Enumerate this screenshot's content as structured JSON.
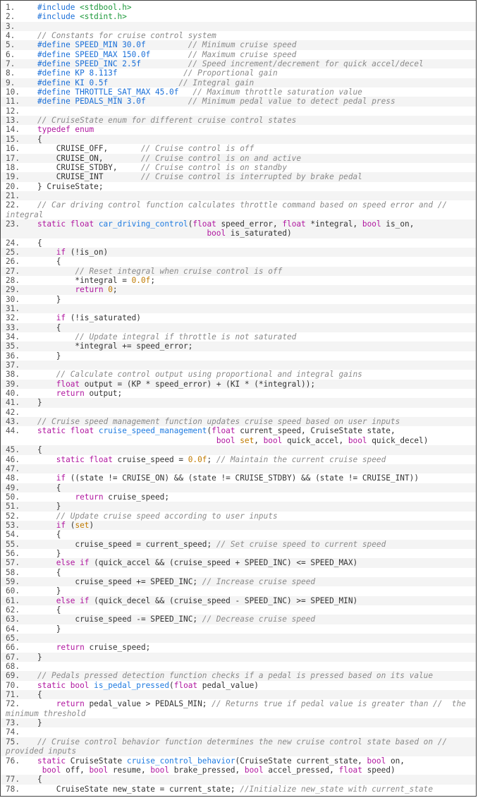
{
  "colors": {
    "preprocessor": "#1a6fd8",
    "string": "#1f9a3c",
    "comment": "#8a8a8a",
    "keyword": "#b0169f",
    "function": "#1f7be0",
    "number": "#c07a00",
    "text": "#333333"
  },
  "rows": [
    {
      "n": "1.",
      "tokens": [
        [
          "p",
          "#include "
        ],
        [
          "s",
          "<stdbool.h>"
        ]
      ]
    },
    {
      "n": "2.",
      "tokens": [
        [
          "p",
          "#include "
        ],
        [
          "s",
          "<stdint.h>"
        ]
      ]
    },
    {
      "n": "3.",
      "tokens": []
    },
    {
      "n": "4.",
      "tokens": [
        [
          "c",
          "// Constants for cruise control system"
        ]
      ]
    },
    {
      "n": "5.",
      "tokens": [
        [
          "p",
          "#define SPEED_MIN 30.0f"
        ],
        [
          "t",
          "         "
        ],
        [
          "c",
          "// Minimum cruise speed"
        ]
      ]
    },
    {
      "n": "6.",
      "tokens": [
        [
          "p",
          "#define SPEED_MAX 150.0f"
        ],
        [
          "t",
          "        "
        ],
        [
          "c",
          "// Maximum cruise speed"
        ]
      ]
    },
    {
      "n": "7.",
      "tokens": [
        [
          "p",
          "#define SPEED_INC 2.5f"
        ],
        [
          "t",
          "          "
        ],
        [
          "c",
          "// Speed increment/decrement for quick accel/decel"
        ]
      ]
    },
    {
      "n": "8.",
      "tokens": [
        [
          "p",
          "#define KP 8.113f"
        ],
        [
          "t",
          "              "
        ],
        [
          "c",
          "// Proportional gain"
        ]
      ]
    },
    {
      "n": "9.",
      "tokens": [
        [
          "p",
          "#define KI 0.5f"
        ],
        [
          "t",
          "               "
        ],
        [
          "c",
          "// Integral gain"
        ]
      ]
    },
    {
      "n": "10.",
      "tokens": [
        [
          "p",
          "#define THROTTLE_SAT_MAX 45.0f"
        ],
        [
          "t",
          "   "
        ],
        [
          "c",
          "// Maximum throttle saturation value"
        ]
      ]
    },
    {
      "n": "11.",
      "tokens": [
        [
          "p",
          "#define PEDALS_MIN 3.0f"
        ],
        [
          "t",
          "         "
        ],
        [
          "c",
          "// Minimum pedal value to detect pedal press"
        ]
      ]
    },
    {
      "n": "12.",
      "tokens": []
    },
    {
      "n": "13.",
      "tokens": [
        [
          "c",
          "// CruiseState enum for different cruise control states"
        ]
      ]
    },
    {
      "n": "14.",
      "tokens": [
        [
          "k",
          "typedef enum"
        ]
      ]
    },
    {
      "n": "15.",
      "tokens": [
        [
          "t",
          "{"
        ]
      ]
    },
    {
      "n": "16.",
      "tokens": [
        [
          "t",
          "    CRUISE_OFF,       "
        ],
        [
          "c",
          "// Cruise control is off"
        ]
      ]
    },
    {
      "n": "17.",
      "tokens": [
        [
          "t",
          "    CRUISE_ON,        "
        ],
        [
          "c",
          "// Cruise control is on and active"
        ]
      ]
    },
    {
      "n": "18.",
      "tokens": [
        [
          "t",
          "    CRUISE_STDBY,     "
        ],
        [
          "c",
          "// Cruise control is on standby"
        ]
      ]
    },
    {
      "n": "19.",
      "tokens": [
        [
          "t",
          "    CRUISE_INT        "
        ],
        [
          "c",
          "// Cruise control is interrupted by brake pedal"
        ]
      ]
    },
    {
      "n": "20.",
      "tokens": [
        [
          "t",
          "} CruiseState;"
        ]
      ]
    },
    {
      "n": "21.",
      "tokens": []
    },
    {
      "n": "22.",
      "tokens": [
        [
          "c",
          "// Car driving control function calculates throttle command based on speed error and //"
        ]
      ]
    },
    {
      "n": "",
      "wrap": true,
      "tokens": [
        [
          "c",
          "integral"
        ]
      ]
    },
    {
      "n": "23.",
      "tokens": [
        [
          "k",
          "static float "
        ],
        [
          "f",
          "car_driving_control"
        ],
        [
          "t",
          "("
        ],
        [
          "k",
          "float"
        ],
        [
          "t",
          " speed_error, "
        ],
        [
          "k",
          "float"
        ],
        [
          "t",
          " *integral, "
        ],
        [
          "k",
          "bool"
        ],
        [
          "t",
          " is_on,"
        ]
      ]
    },
    {
      "n": "",
      "tokens": [
        [
          "t",
          "                                    "
        ],
        [
          "k",
          "bool"
        ],
        [
          "t",
          " is_saturated)"
        ]
      ]
    },
    {
      "n": "24.",
      "tokens": [
        [
          "t",
          "{"
        ]
      ]
    },
    {
      "n": "25.",
      "tokens": [
        [
          "t",
          "    "
        ],
        [
          "k",
          "if"
        ],
        [
          "t",
          " (!is_on)"
        ]
      ]
    },
    {
      "n": "26.",
      "tokens": [
        [
          "t",
          "    {"
        ]
      ]
    },
    {
      "n": "27.",
      "tokens": [
        [
          "t",
          "        "
        ],
        [
          "c",
          "// Reset integral when cruise control is off"
        ]
      ]
    },
    {
      "n": "28.",
      "tokens": [
        [
          "t",
          "        *integral = "
        ],
        [
          "n",
          "0.0f"
        ],
        [
          "t",
          ";"
        ]
      ]
    },
    {
      "n": "29.",
      "tokens": [
        [
          "t",
          "        "
        ],
        [
          "k",
          "return "
        ],
        [
          "n",
          "0"
        ],
        [
          "t",
          ";"
        ]
      ]
    },
    {
      "n": "30.",
      "tokens": [
        [
          "t",
          "    }"
        ]
      ]
    },
    {
      "n": "31.",
      "tokens": []
    },
    {
      "n": "32.",
      "tokens": [
        [
          "t",
          "    "
        ],
        [
          "k",
          "if"
        ],
        [
          "t",
          " (!is_saturated)"
        ]
      ]
    },
    {
      "n": "33.",
      "tokens": [
        [
          "t",
          "    {"
        ]
      ]
    },
    {
      "n": "34.",
      "tokens": [
        [
          "t",
          "        "
        ],
        [
          "c",
          "// Update integral if throttle is not saturated"
        ]
      ]
    },
    {
      "n": "35.",
      "tokens": [
        [
          "t",
          "        *integral += speed_error;"
        ]
      ]
    },
    {
      "n": "36.",
      "tokens": [
        [
          "t",
          "    }"
        ]
      ]
    },
    {
      "n": "37.",
      "tokens": []
    },
    {
      "n": "38.",
      "tokens": [
        [
          "t",
          "    "
        ],
        [
          "c",
          "// Calculate control output using proportional and integral gains"
        ]
      ]
    },
    {
      "n": "39.",
      "tokens": [
        [
          "t",
          "    "
        ],
        [
          "k",
          "float"
        ],
        [
          "t",
          " output = (KP * speed_error) + (KI * (*integral));"
        ]
      ]
    },
    {
      "n": "40.",
      "tokens": [
        [
          "t",
          "    "
        ],
        [
          "k",
          "return"
        ],
        [
          "t",
          " output;"
        ]
      ]
    },
    {
      "n": "41.",
      "tokens": [
        [
          "t",
          "}"
        ]
      ]
    },
    {
      "n": "42.",
      "tokens": []
    },
    {
      "n": "43.",
      "tokens": [
        [
          "c",
          "// Cruise speed management function updates cruise speed based on user inputs"
        ]
      ]
    },
    {
      "n": "44.",
      "tokens": [
        [
          "k",
          "static float "
        ],
        [
          "f",
          "cruise_speed_management"
        ],
        [
          "t",
          "("
        ],
        [
          "k",
          "float"
        ],
        [
          "t",
          " current_speed, CruiseState state,"
        ]
      ]
    },
    {
      "n": "",
      "tokens": [
        [
          "t",
          "                                      "
        ],
        [
          "k",
          "bool"
        ],
        [
          "t",
          " "
        ],
        [
          "n",
          "set"
        ],
        [
          "t",
          ", "
        ],
        [
          "k",
          "bool"
        ],
        [
          "t",
          " quick_accel, "
        ],
        [
          "k",
          "bool"
        ],
        [
          "t",
          " quick_decel)"
        ]
      ]
    },
    {
      "n": "45.",
      "tokens": [
        [
          "t",
          "{"
        ]
      ]
    },
    {
      "n": "46.",
      "tokens": [
        [
          "t",
          "    "
        ],
        [
          "k",
          "static float"
        ],
        [
          "t",
          " cruise_speed = "
        ],
        [
          "n",
          "0.0f"
        ],
        [
          "t",
          "; "
        ],
        [
          "c",
          "// Maintain the current cruise speed"
        ]
      ]
    },
    {
      "n": "47.",
      "tokens": []
    },
    {
      "n": "48.",
      "tokens": [
        [
          "t",
          "    "
        ],
        [
          "k",
          "if"
        ],
        [
          "t",
          " ((state != CRUISE_ON) && (state != CRUISE_STDBY) && (state != CRUISE_INT))"
        ]
      ]
    },
    {
      "n": "49.",
      "tokens": [
        [
          "t",
          "    {"
        ]
      ]
    },
    {
      "n": "50.",
      "tokens": [
        [
          "t",
          "        "
        ],
        [
          "k",
          "return"
        ],
        [
          "t",
          " cruise_speed;"
        ]
      ]
    },
    {
      "n": "51.",
      "tokens": [
        [
          "t",
          "    }"
        ]
      ]
    },
    {
      "n": "52.",
      "tokens": [
        [
          "t",
          "    "
        ],
        [
          "c",
          "// Update cruise speed according to user inputs"
        ]
      ]
    },
    {
      "n": "53.",
      "tokens": [
        [
          "t",
          "    "
        ],
        [
          "k",
          "if"
        ],
        [
          "t",
          " ("
        ],
        [
          "n",
          "set"
        ],
        [
          "t",
          ")"
        ]
      ]
    },
    {
      "n": "54.",
      "tokens": [
        [
          "t",
          "    {"
        ]
      ]
    },
    {
      "n": "55.",
      "tokens": [
        [
          "t",
          "        cruise_speed = current_speed; "
        ],
        [
          "c",
          "// Set cruise speed to current speed"
        ]
      ]
    },
    {
      "n": "56.",
      "tokens": [
        [
          "t",
          "    }"
        ]
      ]
    },
    {
      "n": "57.",
      "tokens": [
        [
          "t",
          "    "
        ],
        [
          "k",
          "else if"
        ],
        [
          "t",
          " (quick_accel && (cruise_speed + SPEED_INC) <= SPEED_MAX)"
        ]
      ]
    },
    {
      "n": "58.",
      "tokens": [
        [
          "t",
          "    {"
        ]
      ]
    },
    {
      "n": "59.",
      "tokens": [
        [
          "t",
          "        cruise_speed += SPEED_INC; "
        ],
        [
          "c",
          "// Increase cruise speed"
        ]
      ]
    },
    {
      "n": "60.",
      "tokens": [
        [
          "t",
          "    }"
        ]
      ]
    },
    {
      "n": "61.",
      "tokens": [
        [
          "t",
          "    "
        ],
        [
          "k",
          "else if"
        ],
        [
          "t",
          " (quick_decel && (cruise_speed - SPEED_INC) >= SPEED_MIN)"
        ]
      ]
    },
    {
      "n": "62.",
      "tokens": [
        [
          "t",
          "    {"
        ]
      ]
    },
    {
      "n": "63.",
      "tokens": [
        [
          "t",
          "        cruise_speed -= SPEED_INC; "
        ],
        [
          "c",
          "// Decrease cruise speed"
        ]
      ]
    },
    {
      "n": "64.",
      "tokens": [
        [
          "t",
          "    }"
        ]
      ]
    },
    {
      "n": "65.",
      "tokens": []
    },
    {
      "n": "66.",
      "tokens": [
        [
          "t",
          "    "
        ],
        [
          "k",
          "return"
        ],
        [
          "t",
          " cruise_speed;"
        ]
      ]
    },
    {
      "n": "67.",
      "tokens": [
        [
          "t",
          "}"
        ]
      ]
    },
    {
      "n": "68.",
      "tokens": []
    },
    {
      "n": "69.",
      "tokens": [
        [
          "c",
          "// Pedals pressed detection function checks if a pedal is pressed based on its value"
        ]
      ]
    },
    {
      "n": "70.",
      "tokens": [
        [
          "k",
          "static bool "
        ],
        [
          "f",
          "is_pedal_pressed"
        ],
        [
          "t",
          "("
        ],
        [
          "k",
          "float"
        ],
        [
          "t",
          " pedal_value)"
        ]
      ]
    },
    {
      "n": "71.",
      "tokens": [
        [
          "t",
          "{"
        ]
      ]
    },
    {
      "n": "72.",
      "tokens": [
        [
          "t",
          "    "
        ],
        [
          "k",
          "return"
        ],
        [
          "t",
          " pedal_value > PEDALS_MIN; "
        ],
        [
          "c",
          "// Returns true if pedal value is greater than //  the"
        ]
      ]
    },
    {
      "n": "",
      "wrap": true,
      "tokens": [
        [
          "c",
          "minimum threshold"
        ]
      ]
    },
    {
      "n": "73.",
      "tokens": [
        [
          "t",
          "}"
        ]
      ]
    },
    {
      "n": "74.",
      "tokens": []
    },
    {
      "n": "75.",
      "tokens": [
        [
          "c",
          "// Cruise control behavior function determines the new cruise control state based on //"
        ]
      ]
    },
    {
      "n": "",
      "wrap": true,
      "tokens": [
        [
          "c",
          "provided inputs"
        ]
      ]
    },
    {
      "n": "76.",
      "tokens": [
        [
          "k",
          "static"
        ],
        [
          "t",
          " CruiseState "
        ],
        [
          "f",
          "cruise_control_behavior"
        ],
        [
          "t",
          "(CruiseState current_state, "
        ],
        [
          "k",
          "bool"
        ],
        [
          "t",
          " on,"
        ]
      ]
    },
    {
      "n": "",
      "tokens": [
        [
          "t",
          " "
        ],
        [
          "k",
          "bool"
        ],
        [
          "t",
          " off, "
        ],
        [
          "k",
          "bool"
        ],
        [
          "t",
          " resume, "
        ],
        [
          "k",
          "bool"
        ],
        [
          "t",
          " brake_pressed, "
        ],
        [
          "k",
          "bool"
        ],
        [
          "t",
          " accel_pressed, "
        ],
        [
          "k",
          "float"
        ],
        [
          "t",
          " speed)"
        ]
      ]
    },
    {
      "n": "77.",
      "tokens": [
        [
          "t",
          "{"
        ]
      ]
    },
    {
      "n": "78.",
      "tokens": [
        [
          "t",
          "    CruiseState new_state = current_state; "
        ],
        [
          "c",
          "//Initialize new_state with current_state"
        ]
      ]
    }
  ]
}
